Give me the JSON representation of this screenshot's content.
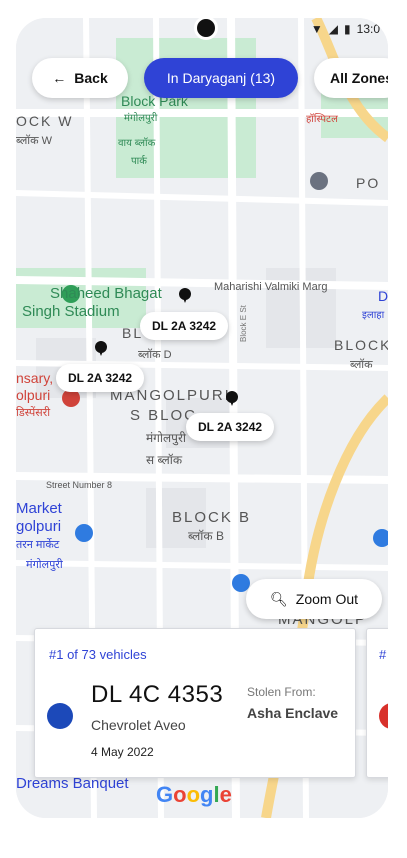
{
  "status": {
    "time": "13:0"
  },
  "top_bar": {
    "back_label": "Back",
    "area_label": "In Daryaganj (13)",
    "zones_label": "All Zones"
  },
  "map_labels": {
    "block_park": "Block Park",
    "mangolpuri_top": "मंगोलपुरी",
    "vay_block": "वाय ब्लॉक",
    "park": "पार्क",
    "ock_w": "OCK W",
    "block_w_hi": "ब्लॉक W",
    "hospital_hi": "हॉस्पिटल",
    "po": "PO",
    "shaheed_1": "Shaheed Bhagat",
    "shaheed_2": "Singh Stadium",
    "maharishi": "Maharishi Valmiki Marg",
    "d_right": "D",
    "block_e_st": "Block E St",
    "illahabad": "इलाहा",
    "bl": "BL",
    "block_d_hi": "ब्लॉक D",
    "block_right": "BLOCK",
    "block_right_hi": "ब्लॉक",
    "nsary": "nsary,",
    "olpuri": "olpuri",
    "dispensary_hi": "डिस्पेंसरी",
    "mangolpuri_big": "MANGOLPURI",
    "s_block": "S BLOC",
    "mangolpuri_mid": "मंगोलपुरी",
    "s_block_hi": "स ब्लॉक",
    "street8": "Street Number 8",
    "market": "Market",
    "golpuri": "golpuri",
    "market_hi": "तरन मार्केट",
    "mangolpuri_low": "मंगोलपुरी",
    "block_b": "BLOCK B",
    "block_b_hi": "ब्लॉक B",
    "mangolp_right": "MANGOLP",
    "dreams": "Dreams Banquet",
    "google": "Google"
  },
  "markers": [
    {
      "label": "DL 2A 3242"
    },
    {
      "label": "DL 2A 3242"
    },
    {
      "label": "DL 2A 3242"
    }
  ],
  "zoom": {
    "label": "Zoom Out",
    "icon": "zoom-out-icon"
  },
  "cards": [
    {
      "count": "#1 of 73 vehicles",
      "plate": "DL 4C 4353",
      "model": "Chevrolet Aveo",
      "date": "4 May 2022",
      "stolen_label": "Stolen From:",
      "stolen_place": "Asha Enclave",
      "dot_color": "#1c49b9"
    },
    {
      "count": "#",
      "dot_color": "#d8312b"
    }
  ],
  "colors": {
    "accent": "#2f43d6",
    "map_bg": "#eef0f3",
    "park": "#c9ebd3",
    "road_yellow": "#f7d68b"
  }
}
